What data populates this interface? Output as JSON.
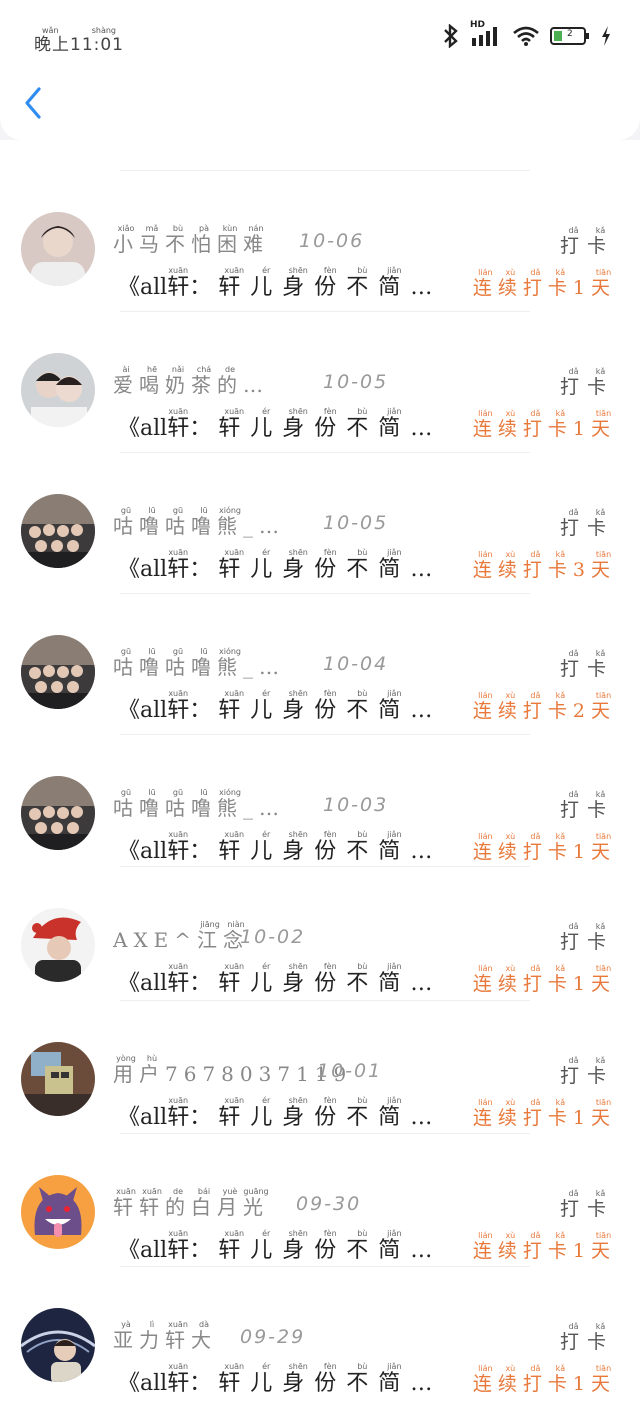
{
  "status_bar": {
    "time": "晚上11:01",
    "time_ruby": "wǎn shàng",
    "network": "HD",
    "battery": "2"
  },
  "nav": {
    "back_icon": "chevron-left-icon"
  },
  "rows": [
    {
      "name": "小马不怕困难",
      "name_ruby": "xiǎo mǎ bù pà kùn nán",
      "date": "10-06",
      "avatar": "boy-portrait",
      "message": "《all轩： 轩儿身份不简…",
      "punch": "打卡",
      "streak": "连续打卡1天"
    },
    {
      "name": "爱喝奶茶的…",
      "name_ruby": "ài hē nǎi chá de",
      "date": "10-05",
      "avatar": "two-boys",
      "message": "《all轩： 轩儿身份不简…",
      "punch": "打卡",
      "streak": "连续打卡1天"
    },
    {
      "name": "咕噜咕噜熊_…",
      "name_ruby": "gū lū gū lū xióng",
      "date": "10-05",
      "avatar": "group-photo",
      "message": "《all轩： 轩儿身份不简…",
      "punch": "打卡",
      "streak": "连续打卡3天"
    },
    {
      "name": "咕噜咕噜熊_…",
      "name_ruby": "gū lū gū lū xióng",
      "date": "10-04",
      "avatar": "group-photo",
      "message": "《all轩： 轩儿身份不简…",
      "punch": "打卡",
      "streak": "连续打卡2天"
    },
    {
      "name": "咕噜咕噜熊_…",
      "name_ruby": "gū lū gū lū xióng",
      "date": "10-03",
      "avatar": "group-photo",
      "message": "《all轩： 轩儿身份不简…",
      "punch": "打卡",
      "streak": "连续打卡1天"
    },
    {
      "name": "AXE^江念",
      "name_ruby": "jiāng niàn",
      "date": "10-02",
      "avatar": "red-hat",
      "message": "《all轩： 轩儿身份不简…",
      "punch": "打卡",
      "streak": "连续打卡1天"
    },
    {
      "name": "用户7678037119",
      "name_ruby": "yòng hù",
      "date": "10-01",
      "avatar": "blurred",
      "message": "《all轩： 轩儿身份不简…",
      "punch": "打卡",
      "streak": "连续打卡1天"
    },
    {
      "name": "轩轩的白月光",
      "name_ruby": "xuān xuān de bái yuè guāng",
      "date": "09-30",
      "avatar": "gengar",
      "message": "《all轩： 轩儿身份不简…",
      "punch": "打卡",
      "streak": "连续打卡1天"
    },
    {
      "name": "亚力轩大",
      "name_ruby": "yà lì xuān dà",
      "date": "09-29",
      "avatar": "stadium",
      "message": "《all轩： 轩儿身份不简…",
      "punch": "打卡",
      "streak": "连续打卡1天"
    }
  ],
  "ruby": {
    "punch": [
      "dǎ",
      "kǎ"
    ],
    "message": [
      "xuān",
      "xuān",
      "ér",
      "shēn",
      "fèn",
      "bù",
      "jiǎn"
    ],
    "streak": [
      "lián",
      "xù",
      "dǎ",
      "kǎ",
      "",
      "tiān"
    ]
  },
  "colors": {
    "streak": "#e8793b",
    "name": "#888888",
    "accent": "#2f8cf0"
  }
}
